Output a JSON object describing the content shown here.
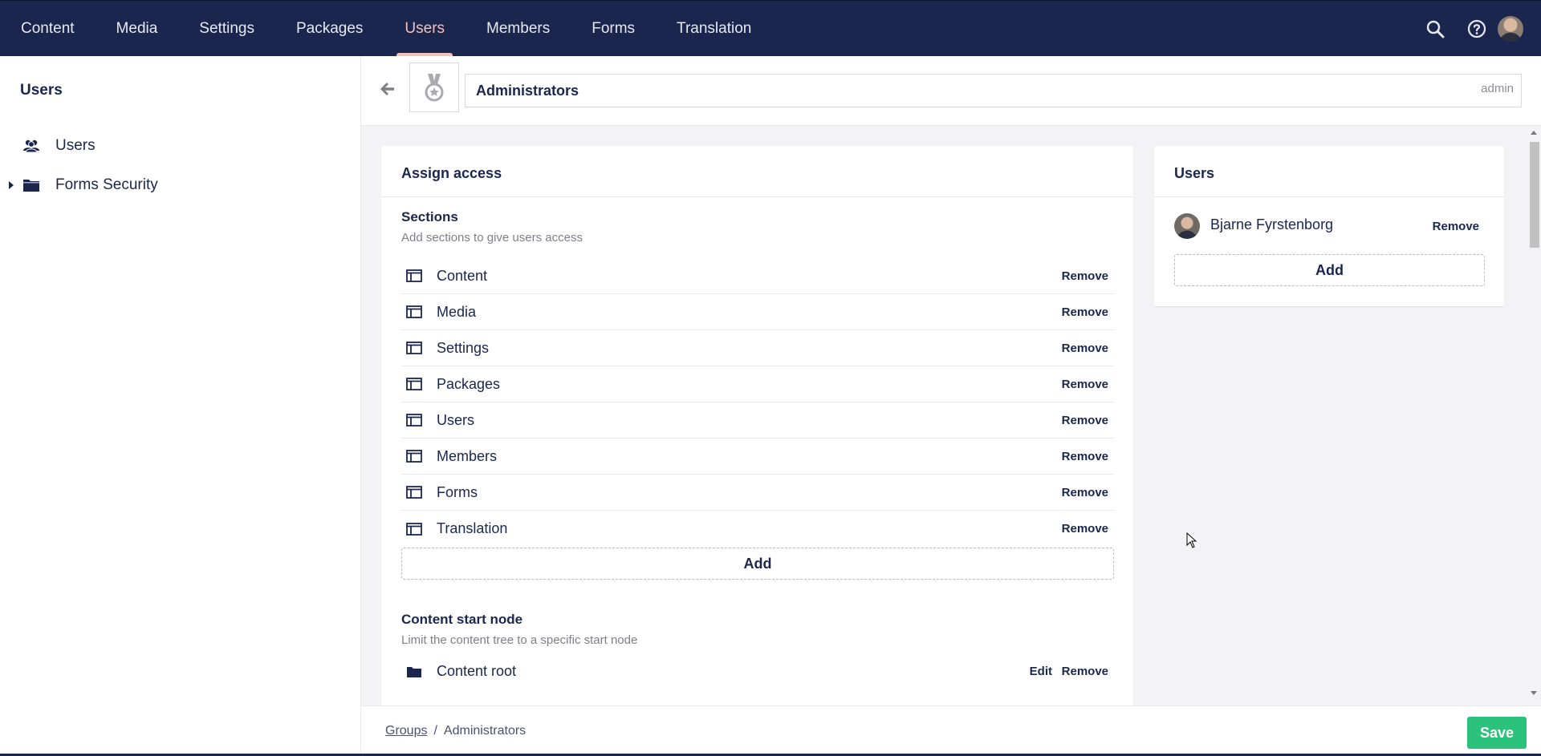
{
  "topnav": {
    "items": [
      {
        "label": "Content"
      },
      {
        "label": "Media"
      },
      {
        "label": "Settings"
      },
      {
        "label": "Packages"
      },
      {
        "label": "Users",
        "active": true
      },
      {
        "label": "Members"
      },
      {
        "label": "Forms"
      },
      {
        "label": "Translation"
      }
    ],
    "tools": [
      "search-icon",
      "help-icon",
      "user-avatar"
    ]
  },
  "sidebar": {
    "title": "Users",
    "items": [
      {
        "label": "Users",
        "icon": "users-icon"
      },
      {
        "label": "Forms Security",
        "icon": "folder-icon",
        "expandable": true
      }
    ]
  },
  "header": {
    "name": "Administrators",
    "alias": "admin",
    "icon": "medal-icon"
  },
  "access": {
    "title": "Assign access",
    "sections": {
      "heading": "Sections",
      "description": "Add sections to give users access",
      "items": [
        {
          "label": "Content"
        },
        {
          "label": "Media"
        },
        {
          "label": "Settings"
        },
        {
          "label": "Packages"
        },
        {
          "label": "Users"
        },
        {
          "label": "Members"
        },
        {
          "label": "Forms"
        },
        {
          "label": "Translation"
        }
      ],
      "add_label": "Add"
    },
    "start_node": {
      "heading": "Content start node",
      "description": "Limit the content tree to a specific start node",
      "value": "Content root",
      "edit_label": "Edit",
      "remove_label": "Remove"
    },
    "remove_label": "Remove"
  },
  "users_panel": {
    "title": "Users",
    "users": [
      {
        "name": "Bjarne Fyrstenborg"
      }
    ],
    "remove_label": "Remove",
    "add_label": "Add"
  },
  "footer": {
    "breadcrumb": {
      "parent": "Groups",
      "separator": "/",
      "current": "Administrators"
    },
    "save_label": "Save"
  },
  "colors": {
    "nav_bg": "#1b264f",
    "nav_active": "#f5c1bc",
    "save_green": "#2bc37c",
    "main_bg": "#f3f3f5"
  }
}
